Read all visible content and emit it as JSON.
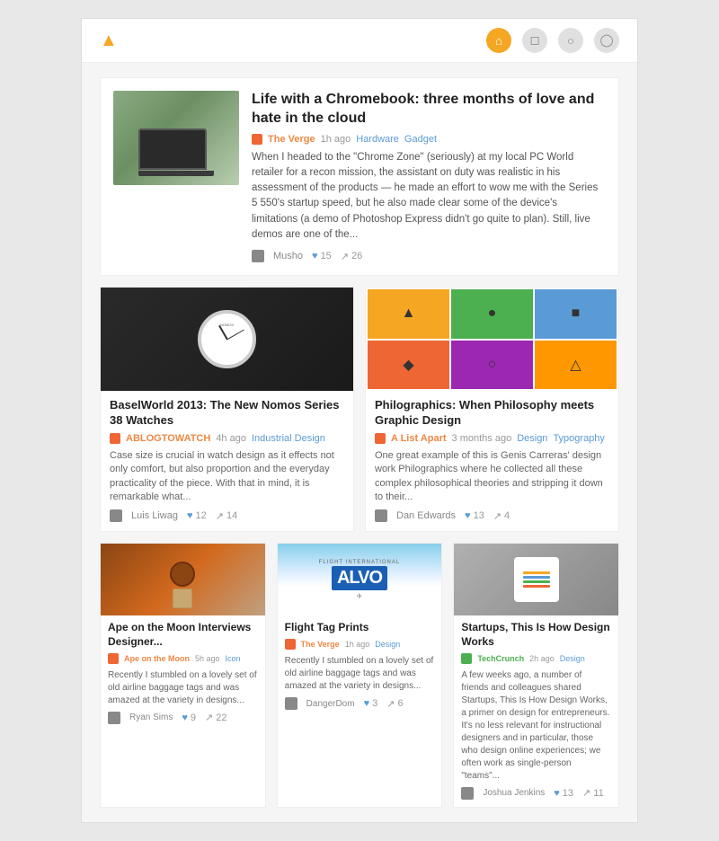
{
  "nav": {
    "logo": "▲",
    "icons": [
      {
        "name": "home",
        "symbol": "⌂",
        "active": true
      },
      {
        "name": "bookmark",
        "symbol": "◻",
        "active": false
      },
      {
        "name": "search",
        "symbol": "○",
        "active": false
      },
      {
        "name": "user",
        "symbol": "◯",
        "active": false
      }
    ]
  },
  "featured": {
    "title": "Life with a Chromebook: three months of love and hate in the cloud",
    "source": "The Verge",
    "time": "1h ago",
    "tag1": "Hardware",
    "tag2": "Gadget",
    "body": "When I headed to the \"Chrome Zone\" (seriously) at my local PC World retailer for a recon mission, the assistant on duty was realistic in his assessment of the products — he made an effort to wow me with the Series 5 550's startup speed, but he also made clear some of the device's limitations (a demo of Photoshop Express didn't go quite to plan). Still, live demos are one of the...",
    "author": "Musho",
    "likes": "15",
    "shares": "26"
  },
  "article_watch": {
    "title": "BaselWorld 2013: The New Nomos Series 38 Watches",
    "source": "ABLOGTOWATCH",
    "time": "4h ago",
    "tag": "Industrial Design",
    "body": "Case size is crucial in watch design as it effects not only comfort, but also proportion and the everyday practicality of the piece. With that in mind, it is remarkable what...",
    "author": "Luis Liwag",
    "likes": "12",
    "shares": "14"
  },
  "article_philo": {
    "title": "Philographics: When Philosophy meets Graphic Design",
    "source": "A List Apart",
    "time": "3 months ago",
    "tag1": "Design",
    "tag2": "Typography",
    "body": "One great example of this is Genis Carreras' design work Philographics where he collected all these complex philosophical theories and stripping it down to their...",
    "author": "Dan Edwards",
    "likes": "13",
    "shares": "4"
  },
  "article_ape": {
    "title": "Ape on the Moon Interviews Designer...",
    "source": "Ape on the Moon",
    "time": "5h ago",
    "tag": "Icon",
    "body": "Recently I stumbled on a lovely set of old airline baggage tags and was amazed at the variety in designs...",
    "author": "Ryan Sims",
    "likes": "9",
    "shares": "22"
  },
  "article_flight": {
    "title": "Flight Tag Prints",
    "source": "The Verge",
    "time": "1h ago",
    "tag": "Design",
    "body": "Recently I stumbled on a lovely set of old airline baggage tags and was amazed at the variety in designs...",
    "author": "DangerDom",
    "likes": "3",
    "shares": "6",
    "flight_label": "FLIGHT INTERNATIONAL",
    "flight_big": "ALVO"
  },
  "article_startup": {
    "title": "Startups, This Is How Design Works",
    "source": "TechCrunch",
    "time": "2h ago",
    "tag": "Design",
    "body": "A few weeks ago, a number of friends and colleagues shared Startups, This Is How Design Works, a primer on design for entrepreneurs. It's no less relevant for instructional designers and in particular, those who design online experiences; we often work as single-person \"teams\"...",
    "author": "Joshua Jenkins",
    "likes": "13",
    "shares": "11"
  }
}
